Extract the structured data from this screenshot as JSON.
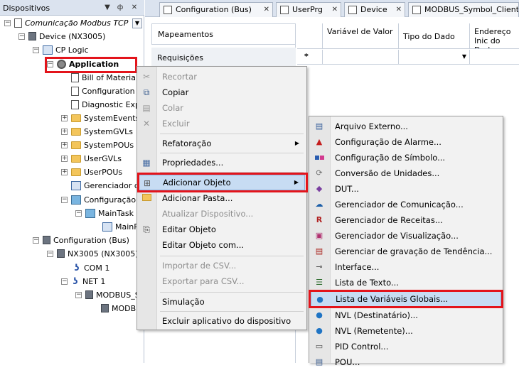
{
  "devices_panel": {
    "title": "Dispositivos",
    "header_icons": [
      "dropdown-arrow-icon",
      "pin-icon",
      "close-icon"
    ],
    "tree": [
      {
        "label": "Comunicação Modbus TCP",
        "italic": true,
        "icon": "project-icon"
      },
      {
        "label": "Device (NX3005)",
        "icon": "device-icon"
      },
      {
        "label": "CP Logic",
        "icon": "cp-logic-icon"
      },
      {
        "label": "Application",
        "bold": true,
        "icon": "gear-icon"
      },
      {
        "label": "Bill of Materials",
        "icon": "document-icon"
      },
      {
        "label": "Configuration a",
        "icon": "document-icon"
      },
      {
        "label": "Diagnostic Exp",
        "icon": "document-icon"
      },
      {
        "label": "SystemEvents",
        "icon": "folder-icon"
      },
      {
        "label": "SystemGVLs",
        "icon": "folder-icon"
      },
      {
        "label": "SystemPOUs",
        "icon": "folder-icon"
      },
      {
        "label": "UserGVLs",
        "icon": "folder-icon"
      },
      {
        "label": "UserPOUs",
        "icon": "folder-icon"
      },
      {
        "label": "Gerenciador de",
        "icon": "library-icon"
      },
      {
        "label": "Configuração d",
        "icon": "task-config-icon"
      },
      {
        "label": "MainTask",
        "icon": "task-icon"
      },
      {
        "label": "MainPr",
        "icon": "program-icon"
      },
      {
        "label": "Configuration (Bus)",
        "icon": "device-icon"
      },
      {
        "label": "NX3005 (NX3005)",
        "icon": "device-icon"
      },
      {
        "label": "COM 1",
        "icon": "cable-icon"
      },
      {
        "label": "NET 1",
        "icon": "cable-icon"
      },
      {
        "label": "MODBUS_S",
        "icon": "device-icon"
      },
      {
        "label": "MODB",
        "icon": "device-icon"
      }
    ]
  },
  "tabs": [
    {
      "label": "Configuration (Bus)"
    },
    {
      "label": "UserPrg"
    },
    {
      "label": "Device"
    },
    {
      "label": "MODBUS_Symbol_Client"
    }
  ],
  "left_nav": {
    "items": [
      {
        "label": "Mapeamentos"
      },
      {
        "label": "Requisições"
      }
    ]
  },
  "grid": {
    "columns": [
      "Variável de Valor",
      "Tipo do Dado",
      "Endereço Inic do Dado"
    ],
    "new_row_marker": "*"
  },
  "context_menu": {
    "items": [
      {
        "label": "Recortar",
        "disabled": true,
        "icon": "scissors-icon"
      },
      {
        "label": "Copiar",
        "disabled": false,
        "icon": "copy-icon"
      },
      {
        "label": "Colar",
        "disabled": true,
        "icon": "paste-icon"
      },
      {
        "label": "Excluir",
        "disabled": true,
        "icon": "delete-icon"
      },
      {
        "label": "Refatoração",
        "disabled": false,
        "submenu": true
      },
      {
        "label": "Propriedades...",
        "disabled": false,
        "icon": "properties-icon"
      },
      {
        "label": "Adicionar Objeto",
        "disabled": false,
        "submenu": true,
        "highlighted": true,
        "icon": "add-object-icon"
      },
      {
        "label": "Adicionar Pasta...",
        "disabled": false,
        "icon": "folder-icon"
      },
      {
        "label": "Atualizar Dispositivo...",
        "disabled": true
      },
      {
        "label": "Editar Objeto",
        "disabled": false,
        "icon": "edit-object-icon"
      },
      {
        "label": "Editar Objeto com...",
        "disabled": false
      },
      {
        "label": "Importar de CSV...",
        "disabled": true
      },
      {
        "label": "Exportar para CSV...",
        "disabled": true
      },
      {
        "label": "Simulação",
        "disabled": false
      },
      {
        "label": "Excluir aplicativo do dispositivo",
        "disabled": false
      }
    ]
  },
  "submenu": {
    "items": [
      {
        "label": "Arquivo Externo...",
        "icon": "external-file-icon"
      },
      {
        "label": "Configuração de Alarme...",
        "icon": "alarm-icon"
      },
      {
        "label": "Configuração de Símbolo...",
        "icon": "symbol-icon"
      },
      {
        "label": "Conversão de Unidades...",
        "icon": "unit-conversion-icon"
      },
      {
        "label": "DUT...",
        "icon": "dut-icon"
      },
      {
        "label": "Gerenciador de Comunicação...",
        "icon": "communication-manager-icon"
      },
      {
        "label": "Gerenciador de Receitas...",
        "icon": "recipe-manager-icon"
      },
      {
        "label": "Gerenciador de Visualização...",
        "icon": "visualization-manager-icon"
      },
      {
        "label": "Gerenciar de gravação de Tendência...",
        "icon": "trend-icon"
      },
      {
        "label": "Interface...",
        "icon": "interface-icon"
      },
      {
        "label": "Lista de Texto...",
        "icon": "text-list-icon"
      },
      {
        "label": "Lista de Variáveis Globais...",
        "icon": "globe-icon",
        "highlighted": true
      },
      {
        "label": "NVL (Destinatário)...",
        "icon": "globe-icon"
      },
      {
        "label": "NVL (Remetente)...",
        "icon": "globe-icon"
      },
      {
        "label": "PID Control...",
        "icon": "pid-icon"
      },
      {
        "label": "POU...",
        "icon": "pou-icon"
      }
    ]
  },
  "colors": {
    "highlight_box": "#e3141b",
    "menu_highlight": "#c7dcf3",
    "panel_header": "#dbe3ef"
  }
}
